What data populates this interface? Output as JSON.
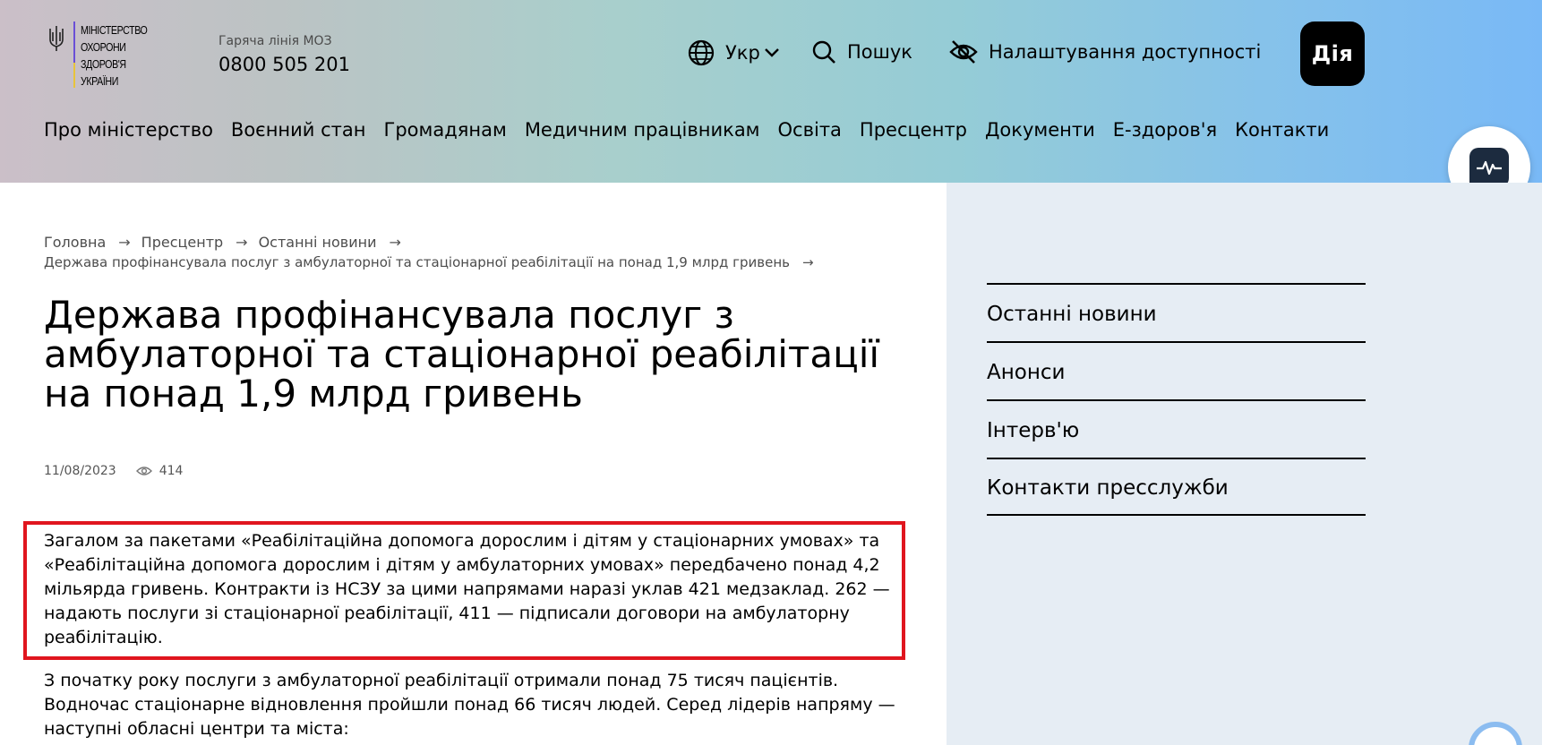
{
  "logo": {
    "lines": [
      "Міністерство",
      "охорони",
      "здоров'я",
      "України"
    ]
  },
  "hotline": {
    "label": "Гаряча лінія МОЗ",
    "number": "0800 505 201"
  },
  "topbar": {
    "lang": "Укр",
    "search": "Пошук",
    "accessibility": "Налаштування доступності",
    "diia": "Дія"
  },
  "nav": [
    "Про міністерство",
    "Воєнний стан",
    "Громадянам",
    "Медичним працівникам",
    "Освіта",
    "Пресцентр",
    "Документи",
    "Е-здоров'я",
    "Контакти"
  ],
  "breadcrumb": {
    "items": [
      "Головна",
      "Пресцентр",
      "Останні новини"
    ],
    "current": "Держава профінансувала послуг з амбулаторної та стаціонарної реабілітації на понад 1,9 млрд гривень"
  },
  "article": {
    "title": "Держава профінансувала послуг з амбулаторної та стаціонарної реабілітації на понад 1,9 млрд гривень",
    "date": "11/08/2023",
    "views": "414",
    "paragraph1": "Загалом за пакетами «Реабілітаційна допомога дорослим і дітям у стаціонарних умовах» та «Реабілітаційна допомога дорослим і дітям у амбулаторних умовах» передбачено понад 4,2 мільярда гривень. Контракти із НСЗУ за цими напрямами наразі уклав 421 медзаклад. 262 — надають послуги зі стаціонарної реабілітації, 411 — підписали договори на амбулаторну реабілітацію.",
    "paragraph2": "З початку року послуги з амбулаторної реабілітації отримали понад 75 тисяч пацієнтів. Водночас стаціонарне відновлення пройшли понад 66 тисяч людей. Серед лідерів напряму — наступні обласні центри та міста:"
  },
  "sidebar": [
    "Останні новини",
    "Анонси",
    "Інтерв'ю",
    "Контакти пресслужби"
  ],
  "colors": {
    "highlight": "#e0151e",
    "sidebar_bg": "#e6edf4"
  }
}
